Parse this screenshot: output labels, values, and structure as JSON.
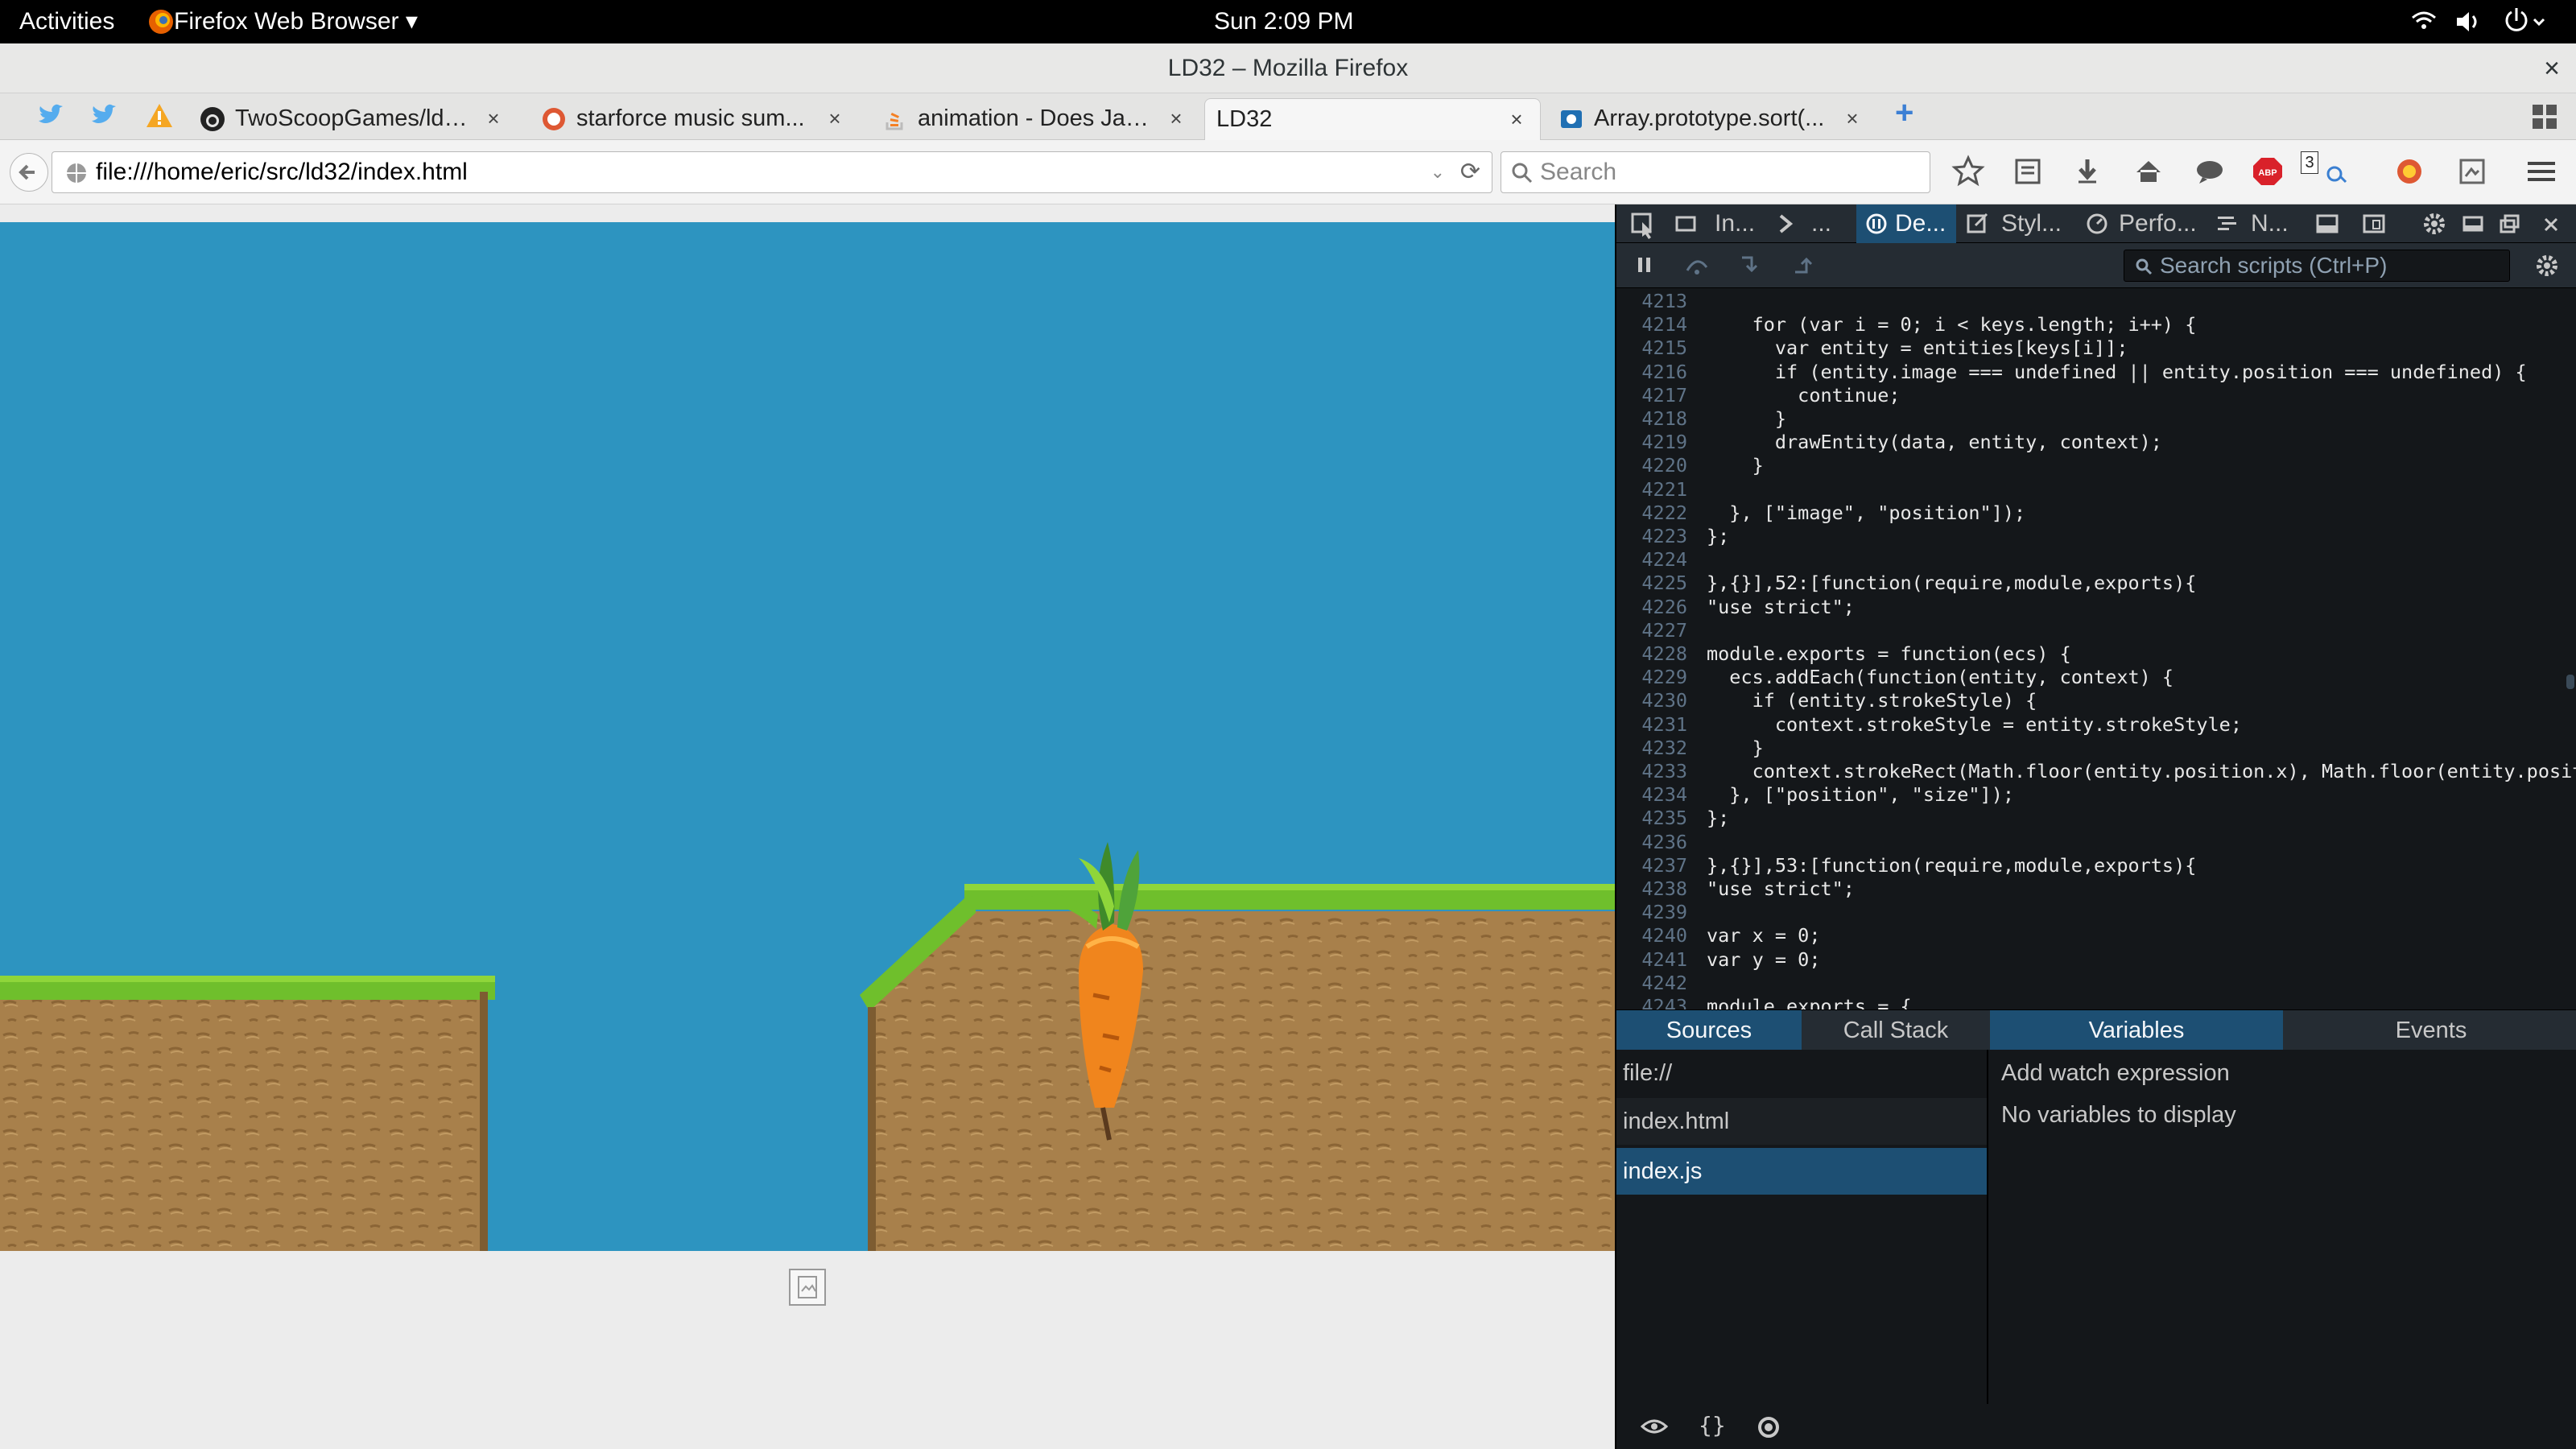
{
  "topbar": {
    "activities": "Activities",
    "app_menu": "Firefox Web Browser ▾",
    "clock": "Sun  2:09 PM"
  },
  "window": {
    "title": "LD32 – Mozilla Firefox",
    "close": "×"
  },
  "tabs": [
    {
      "label": "TwoScoopGames/ld32",
      "close": "×"
    },
    {
      "label": "starforce music sum...",
      "close": "×"
    },
    {
      "label": "animation - Does Jav...",
      "close": "×"
    },
    {
      "label": "LD32",
      "close": "×"
    },
    {
      "label": "Array.prototype.sort(...",
      "close": "×"
    }
  ],
  "new_tab": "+",
  "navbar": {
    "url": "file:///home/eric/src/ld32/index.html",
    "search_placeholder": "Search",
    "downloads_badge": "3"
  },
  "devtools": {
    "tabs": [
      "In...",
      "...",
      "De...",
      "Styl...",
      "Perfo...",
      "N..."
    ],
    "search_placeholder": "Search scripts (Ctrl+P)",
    "code_lines": [
      {
        "n": "4213",
        "t": ""
      },
      {
        "n": "4214",
        "t": "    for (var i = 0; i < keys.length; i++) {"
      },
      {
        "n": "4215",
        "t": "      var entity = entities[keys[i]];"
      },
      {
        "n": "4216",
        "t": "      if (entity.image === undefined || entity.position === undefined) {"
      },
      {
        "n": "4217",
        "t": "        continue;"
      },
      {
        "n": "4218",
        "t": "      }"
      },
      {
        "n": "4219",
        "t": "      drawEntity(data, entity, context);"
      },
      {
        "n": "4220",
        "t": "    }"
      },
      {
        "n": "4221",
        "t": ""
      },
      {
        "n": "4222",
        "t": "  }, [\"image\", \"position\"]);"
      },
      {
        "n": "4223",
        "t": "};"
      },
      {
        "n": "4224",
        "t": ""
      },
      {
        "n": "4225",
        "t": "},{}],52:[function(require,module,exports){"
      },
      {
        "n": "4226",
        "t": "\"use strict\";"
      },
      {
        "n": "4227",
        "t": ""
      },
      {
        "n": "4228",
        "t": "module.exports = function(ecs) {"
      },
      {
        "n": "4229",
        "t": "  ecs.addEach(function(entity, context) {"
      },
      {
        "n": "4230",
        "t": "    if (entity.strokeStyle) {"
      },
      {
        "n": "4231",
        "t": "      context.strokeStyle = entity.strokeStyle;"
      },
      {
        "n": "4232",
        "t": "    }"
      },
      {
        "n": "4233",
        "t": "    context.strokeRect(Math.floor(entity.position.x), Math.floor(entity.posit"
      },
      {
        "n": "4234",
        "t": "  }, [\"position\", \"size\"]);"
      },
      {
        "n": "4235",
        "t": "};"
      },
      {
        "n": "4236",
        "t": ""
      },
      {
        "n": "4237",
        "t": "},{}],53:[function(require,module,exports){"
      },
      {
        "n": "4238",
        "t": "\"use strict\";"
      },
      {
        "n": "4239",
        "t": ""
      },
      {
        "n": "4240",
        "t": "var x = 0;"
      },
      {
        "n": "4241",
        "t": "var y = 0;"
      },
      {
        "n": "4242",
        "t": ""
      },
      {
        "n": "4243",
        "t": "module.exports = {"
      }
    ],
    "panel_tabs": {
      "sources": "Sources",
      "call_stack": "Call Stack",
      "variables": "Variables",
      "events": "Events"
    },
    "sources": {
      "group": "file://",
      "files": [
        "index.html",
        "index.js"
      ],
      "selected": "index.js"
    },
    "variables": {
      "add_watch": "Add watch expression",
      "empty": "No variables to display"
    },
    "bottom_buttons": {
      "pretty_print": "{}"
    }
  },
  "colors": {
    "sky": "#2d94c0",
    "grass": "#6fbf2c",
    "dirt": "#a57f4c",
    "selected": "#1d4f73",
    "devtools_bg": "#14171a"
  }
}
